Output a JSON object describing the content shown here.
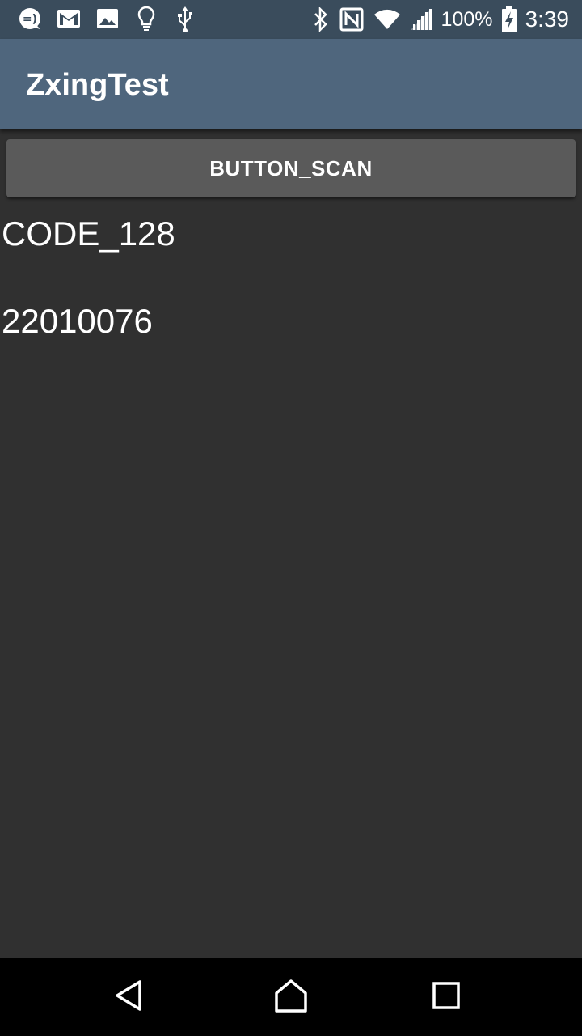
{
  "status_bar": {
    "left_icons": [
      "messenger-icon",
      "gmail-icon",
      "gallery-icon",
      "lightbulb-icon",
      "usb-icon"
    ],
    "right_icons": [
      "bluetooth-icon",
      "nfc-icon",
      "wifi-icon",
      "signal-icon"
    ],
    "battery_percent": "100%",
    "battery_icon": "battery-charging-icon",
    "time": "3:39"
  },
  "app_bar": {
    "title": "ZxingTest"
  },
  "main": {
    "scan_button_label": "BUTTON_SCAN",
    "result_format": "CODE_128",
    "result_content": "22010076"
  },
  "nav_bar": {
    "icons": [
      "back-icon",
      "home-icon",
      "recents-icon"
    ]
  },
  "colors": {
    "status_bar": "#3a4c5c",
    "app_bar": "#4f667d",
    "background": "#303030",
    "button": "#5a5a5a",
    "nav_bar": "#000000"
  }
}
